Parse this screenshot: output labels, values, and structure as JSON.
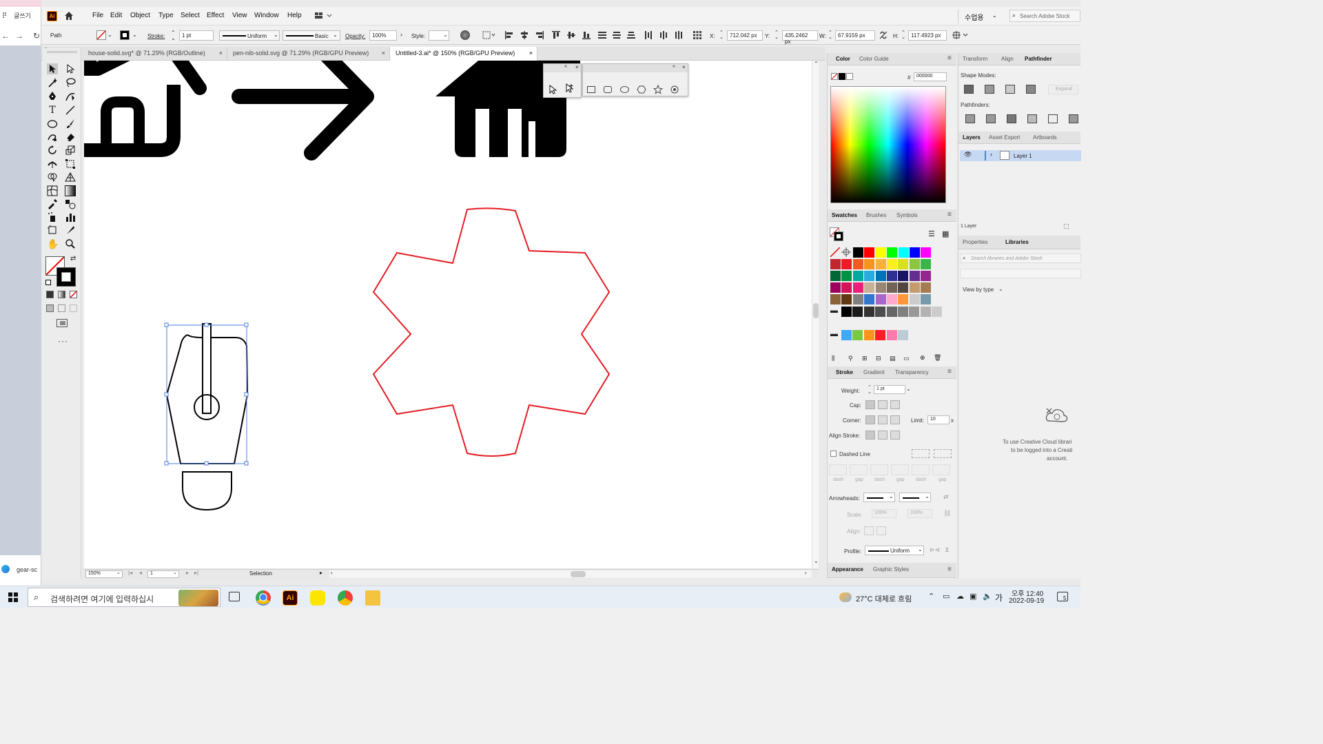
{
  "browser": {
    "tab_label": "글쓰기",
    "bottom_tab_label": "gear-sc"
  },
  "app": {
    "logo_text": "Ai",
    "menu": [
      "File",
      "Edit",
      "Object",
      "Type",
      "Select",
      "Effect",
      "View",
      "Window",
      "Help"
    ],
    "workspace": "수업용",
    "search_placeholder": "Search Adobe Stock"
  },
  "control_bar": {
    "selection_type": "Path",
    "stroke_label": "Stroke:",
    "stroke_weight": "1 pt",
    "stroke_profile": "Uniform",
    "brush": "Basic",
    "opacity_label": "Opacity:",
    "opacity": "100%",
    "style_label": "Style:",
    "x_label": "X:",
    "x_value": "712.042 px",
    "y_label": "Y:",
    "y_value": "435.2462 px",
    "w_label": "W:",
    "w_value": "67.9159 px",
    "h_label": "H:",
    "h_value": "117.4923 px"
  },
  "document_tabs": [
    {
      "label": "house-solid.svg* @ 71.29% (RGB/Outline)",
      "active": false
    },
    {
      "label": "pen-nib-solid.svg @ 71.29% (RGB/GPU Preview)",
      "active": false
    },
    {
      "label": "Untitled-3.ai* @ 150% (RGB/GPU Preview)",
      "active": true
    }
  ],
  "status_bar": {
    "zoom": "150%",
    "artboard": "1",
    "tool": "Selection"
  },
  "color_panel": {
    "tabs": [
      "Color",
      "Color Guide"
    ],
    "hex_label": "#",
    "hex": "000000"
  },
  "swatches_panel": {
    "tabs": [
      "Swatches",
      "Brushes",
      "Symbols"
    ]
  },
  "stroke_panel": {
    "tabs": [
      "Stroke",
      "Gradient",
      "Transparency"
    ],
    "weight_label": "Weight:",
    "weight": "1 pt",
    "cap_label": "Cap:",
    "corner_label": "Corner:",
    "limit_label": "Limit:",
    "limit": "10",
    "limit_unit": "x",
    "align_label": "Align Stroke:",
    "dashed_label": "Dashed Line",
    "dash_labels": [
      "dash",
      "gap",
      "dash",
      "gap",
      "dash",
      "gap"
    ],
    "arrowheads_label": "Arrowheads:",
    "scale_label": "Scale:",
    "scale1": "100%",
    "scale2": "100%",
    "align_arrow_label": "Align:",
    "profile_label": "Profile:",
    "profile": "Uniform"
  },
  "bottom_panel_tabs": [
    "Appearance",
    "Graphic Styles"
  ],
  "pathfinder_panel": {
    "tabs": [
      "Transform",
      "Align",
      "Pathfinder"
    ],
    "shape_modes_label": "Shape Modes:",
    "expand_label": "Expand",
    "pathfinders_label": "Pathfinders:"
  },
  "layers_panel": {
    "tabs": [
      "Layers",
      "Asset Export",
      "Artboards"
    ],
    "layer_name": "Layer 1",
    "count": "1 Layer"
  },
  "libraries_panel": {
    "tabs": [
      "Properties",
      "Libraries"
    ],
    "search_placeholder": "Search libraries and Adobe Stock",
    "view_by": "View by type",
    "message_line1": "To use Creative Cloud librari",
    "message_line2": "to be logged into a Creati",
    "message_line3": "account."
  },
  "taskbar": {
    "search_placeholder": "검색하려면 여기에 입력하십시",
    "weather": "27°C 대체로 흐림",
    "ime": "가",
    "time": "오후 12:40",
    "date": "2022-09-19",
    "notifications": "5"
  },
  "colors": {
    "selection_blue": "#4a7fe0",
    "gear_red": "#e51c23",
    "ai_orange": "#ff9a00"
  },
  "swatch_colors": [
    [
      "#ffffff",
      "#ffffff",
      "#000000",
      "#ff0000",
      "#ffff00",
      "#00ff00",
      "#00ffff",
      "#0000ff",
      "#ff00ff"
    ],
    [
      "#c1272d",
      "#ed1c24",
      "#f15a24",
      "#f7931e",
      "#fbb03b",
      "#fcee21",
      "#d9e021",
      "#8cc63f",
      "#39b54a"
    ],
    [
      "#006837",
      "#009245",
      "#00a99d",
      "#29abe2",
      "#0071bc",
      "#2e3192",
      "#1b1464",
      "#662d91",
      "#93278f"
    ],
    [
      "#9e005d",
      "#d4145a",
      "#ed1e79",
      "#c7b299",
      "#998675",
      "#736357",
      "#534741",
      "#c69c6d",
      "#a67c52"
    ],
    [
      "#8c6239",
      "#603813",
      "#7f7f7f",
      "#3377cc",
      "#aa66cc",
      "#ffaacc",
      "#ff9933",
      "#cccccc",
      "#7799aa"
    ],
    [
      "#000000",
      "#1a1a1a",
      "#333333",
      "#4d4d4d",
      "#666666",
      "#808080",
      "#999999",
      "#b3b3b3",
      "#cccccc"
    ],
    [
      "#3fa9f5",
      "#7ac943",
      "#ff931e",
      "#ff1d25",
      "#ff7bac",
      "#bdccd4"
    ]
  ]
}
